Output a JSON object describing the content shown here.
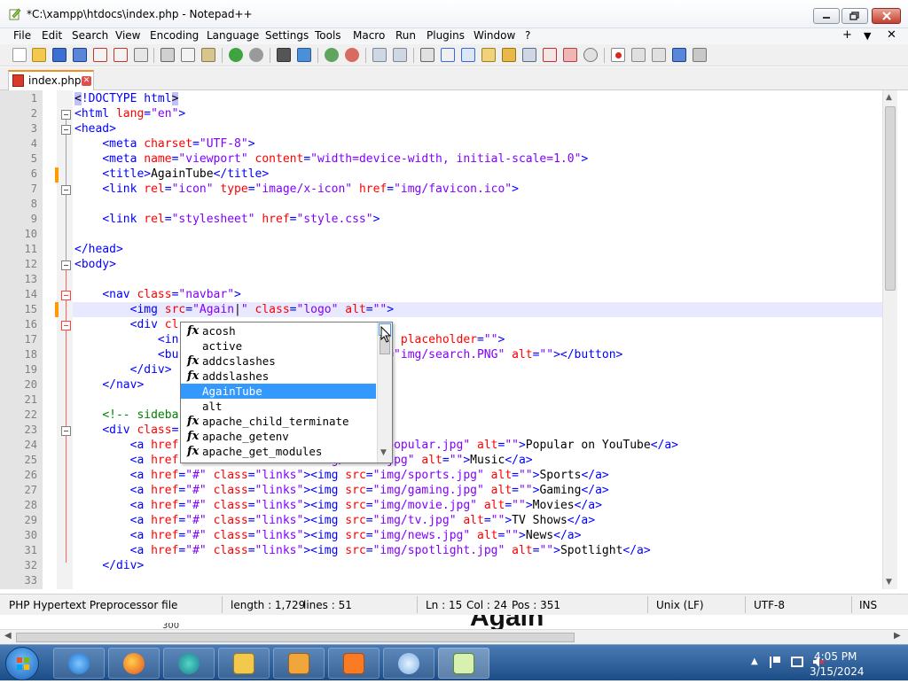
{
  "window": {
    "title": "*C:\\xampp\\htdocs\\index.php - Notepad++"
  },
  "menu": [
    "File",
    "Edit",
    "Search",
    "View",
    "Encoding",
    "Language",
    "Settings",
    "Tools",
    "Macro",
    "Run",
    "Plugins",
    "Window",
    "?"
  ],
  "menu_right": {
    "plus": "+",
    "down": "▼",
    "close": "✕"
  },
  "tab": {
    "label": "index.php"
  },
  "code_lines": [
    {
      "n": "1",
      "parts": [
        [
          "brk",
          "<"
        ],
        [
          "tag",
          "!DOCTYPE html"
        ],
        [
          "brk",
          ">"
        ]
      ]
    },
    {
      "n": "2",
      "parts": [
        [
          "tag",
          "<html "
        ],
        [
          "attr",
          "lang"
        ],
        [
          "tag",
          "="
        ],
        [
          "val",
          "\"en\""
        ],
        [
          "tag",
          ">"
        ]
      ]
    },
    {
      "n": "3",
      "parts": [
        [
          "tag",
          "<head>"
        ]
      ]
    },
    {
      "n": "4",
      "parts": [
        [
          "txt",
          "    "
        ],
        [
          "tag",
          "<meta "
        ],
        [
          "attr",
          "charset"
        ],
        [
          "tag",
          "="
        ],
        [
          "val",
          "\"UTF-8\""
        ],
        [
          "tag",
          ">"
        ]
      ]
    },
    {
      "n": "5",
      "parts": [
        [
          "txt",
          "    "
        ],
        [
          "tag",
          "<meta "
        ],
        [
          "attr",
          "name"
        ],
        [
          "tag",
          "="
        ],
        [
          "val",
          "\"viewport\""
        ],
        [
          "tag",
          " "
        ],
        [
          "attr",
          "content"
        ],
        [
          "tag",
          "="
        ],
        [
          "val",
          "\"width=device-width, initial-scale=1.0\""
        ],
        [
          "tag",
          ">"
        ]
      ]
    },
    {
      "n": "6",
      "parts": [
        [
          "txt",
          "    "
        ],
        [
          "tag",
          "<title>"
        ],
        [
          "txt",
          "AgainTube"
        ],
        [
          "tag",
          "</title>"
        ]
      ]
    },
    {
      "n": "7",
      "parts": [
        [
          "txt",
          "    "
        ],
        [
          "tag",
          "<link "
        ],
        [
          "attr",
          "rel"
        ],
        [
          "tag",
          "="
        ],
        [
          "val",
          "\"icon\""
        ],
        [
          "tag",
          " "
        ],
        [
          "attr",
          "type"
        ],
        [
          "tag",
          "="
        ],
        [
          "val",
          "\"image/x-icon\""
        ],
        [
          "tag",
          " "
        ],
        [
          "attr",
          "href"
        ],
        [
          "tag",
          "="
        ],
        [
          "val",
          "\"img/favicon.ico\""
        ],
        [
          "tag",
          ">"
        ]
      ]
    },
    {
      "n": "8",
      "parts": []
    },
    {
      "n": "9",
      "parts": [
        [
          "txt",
          "    "
        ],
        [
          "tag",
          "<link "
        ],
        [
          "attr",
          "rel"
        ],
        [
          "tag",
          "="
        ],
        [
          "val",
          "\"stylesheet\""
        ],
        [
          "tag",
          " "
        ],
        [
          "attr",
          "href"
        ],
        [
          "tag",
          "="
        ],
        [
          "val",
          "\"style.css\""
        ],
        [
          "tag",
          ">"
        ]
      ]
    },
    {
      "n": "10",
      "parts": []
    },
    {
      "n": "11",
      "parts": [
        [
          "tag",
          "</head>"
        ]
      ]
    },
    {
      "n": "12",
      "parts": [
        [
          "tag",
          "<body>"
        ]
      ]
    },
    {
      "n": "13",
      "parts": []
    },
    {
      "n": "14",
      "parts": [
        [
          "txt",
          "    "
        ],
        [
          "tag",
          "<nav "
        ],
        [
          "attr",
          "class"
        ],
        [
          "tag",
          "="
        ],
        [
          "val",
          "\"navbar\""
        ],
        [
          "tag",
          ">"
        ]
      ]
    },
    {
      "n": "15",
      "parts": [
        [
          "txt",
          "        "
        ],
        [
          "tag",
          "<img "
        ],
        [
          "attr",
          "src"
        ],
        [
          "tag",
          "="
        ],
        [
          "val",
          "\"Again"
        ],
        [
          "txt",
          "|"
        ],
        [
          "val",
          "\""
        ],
        [
          "tag",
          " "
        ],
        [
          "attr",
          "class"
        ],
        [
          "tag",
          "="
        ],
        [
          "val",
          "\"logo\""
        ],
        [
          "tag",
          " "
        ],
        [
          "attr",
          "alt"
        ],
        [
          "tag",
          "="
        ],
        [
          "val",
          "\"\""
        ],
        [
          "tag",
          ">"
        ]
      ]
    },
    {
      "n": "16",
      "parts": [
        [
          "txt",
          "        "
        ],
        [
          "tag",
          "<div "
        ],
        [
          "attr",
          "cl"
        ]
      ]
    },
    {
      "n": "17",
      "parts": [
        [
          "txt",
          "            "
        ],
        [
          "tag",
          "<in"
        ],
        [
          "txt",
          "                           "
        ],
        [
          "val",
          "bar\""
        ],
        [
          "tag",
          " "
        ],
        [
          "attr",
          "placeholder"
        ],
        [
          "tag",
          "="
        ],
        [
          "val",
          "\"\""
        ],
        [
          "tag",
          ">"
        ]
      ]
    },
    {
      "n": "18",
      "parts": [
        [
          "txt",
          "            "
        ],
        [
          "tag",
          "<bu"
        ],
        [
          "txt",
          "                           "
        ],
        [
          "attr",
          "src"
        ],
        [
          "tag",
          "="
        ],
        [
          "val",
          "\"img/search.PNG\""
        ],
        [
          "tag",
          " "
        ],
        [
          "attr",
          "alt"
        ],
        [
          "tag",
          "="
        ],
        [
          "val",
          "\"\""
        ],
        [
          "tag",
          "></button>"
        ]
      ]
    },
    {
      "n": "19",
      "parts": [
        [
          "txt",
          "        "
        ],
        [
          "tag",
          "</div>"
        ]
      ]
    },
    {
      "n": "20",
      "parts": [
        [
          "txt",
          "    "
        ],
        [
          "tag",
          "</nav>"
        ]
      ]
    },
    {
      "n": "21",
      "parts": []
    },
    {
      "n": "22",
      "parts": [
        [
          "txt",
          "    "
        ],
        [
          "cmt",
          "<!-- sideba"
        ]
      ]
    },
    {
      "n": "23",
      "parts": [
        [
          "txt",
          "    "
        ],
        [
          "tag",
          "<div "
        ],
        [
          "attr",
          "class"
        ],
        [
          "tag",
          "="
        ]
      ]
    },
    {
      "n": "24",
      "parts": [
        [
          "txt",
          "        "
        ],
        [
          "tag",
          "<a "
        ],
        [
          "attr",
          "href"
        ],
        [
          "txt",
          "                     "
        ],
        [
          "attr",
          "src"
        ],
        [
          "tag",
          "="
        ],
        [
          "val",
          "\"img/popular.jpg\""
        ],
        [
          "tag",
          " "
        ],
        [
          "attr",
          "alt"
        ],
        [
          "tag",
          "="
        ],
        [
          "val",
          "\"\""
        ],
        [
          "tag",
          ">"
        ],
        [
          "txt",
          "Popular on YouTube"
        ],
        [
          "tag",
          "</a>"
        ]
      ]
    },
    {
      "n": "25",
      "parts": [
        [
          "txt",
          "        "
        ],
        [
          "tag",
          "<a "
        ],
        [
          "attr",
          "href"
        ],
        [
          "txt",
          "                     "
        ],
        [
          "val",
          "mg/music.jpg\""
        ],
        [
          "tag",
          " "
        ],
        [
          "attr",
          "alt"
        ],
        [
          "tag",
          "="
        ],
        [
          "val",
          "\"\""
        ],
        [
          "tag",
          ">"
        ],
        [
          "txt",
          "Music"
        ],
        [
          "tag",
          "</a>"
        ]
      ]
    },
    {
      "n": "26",
      "parts": [
        [
          "txt",
          "        "
        ],
        [
          "tag",
          "<a "
        ],
        [
          "attr",
          "href"
        ],
        [
          "tag",
          "="
        ],
        [
          "val",
          "\"#\""
        ],
        [
          "tag",
          " "
        ],
        [
          "attr",
          "class"
        ],
        [
          "tag",
          "="
        ],
        [
          "val",
          "\"links\""
        ],
        [
          "tag",
          "><img "
        ],
        [
          "attr",
          "src"
        ],
        [
          "tag",
          "="
        ],
        [
          "val",
          "\"img/sports.jpg\""
        ],
        [
          "tag",
          " "
        ],
        [
          "attr",
          "alt"
        ],
        [
          "tag",
          "="
        ],
        [
          "val",
          "\"\""
        ],
        [
          "tag",
          ">"
        ],
        [
          "txt",
          "Sports"
        ],
        [
          "tag",
          "</a>"
        ]
      ]
    },
    {
      "n": "27",
      "parts": [
        [
          "txt",
          "        "
        ],
        [
          "tag",
          "<a "
        ],
        [
          "attr",
          "href"
        ],
        [
          "tag",
          "="
        ],
        [
          "val",
          "\"#\""
        ],
        [
          "tag",
          " "
        ],
        [
          "attr",
          "class"
        ],
        [
          "tag",
          "="
        ],
        [
          "val",
          "\"links\""
        ],
        [
          "tag",
          "><img "
        ],
        [
          "attr",
          "src"
        ],
        [
          "tag",
          "="
        ],
        [
          "val",
          "\"img/gaming.jpg\""
        ],
        [
          "tag",
          " "
        ],
        [
          "attr",
          "alt"
        ],
        [
          "tag",
          "="
        ],
        [
          "val",
          "\"\""
        ],
        [
          "tag",
          ">"
        ],
        [
          "txt",
          "Gaming"
        ],
        [
          "tag",
          "</a>"
        ]
      ]
    },
    {
      "n": "28",
      "parts": [
        [
          "txt",
          "        "
        ],
        [
          "tag",
          "<a "
        ],
        [
          "attr",
          "href"
        ],
        [
          "tag",
          "="
        ],
        [
          "val",
          "\"#\""
        ],
        [
          "tag",
          " "
        ],
        [
          "attr",
          "class"
        ],
        [
          "tag",
          "="
        ],
        [
          "val",
          "\"links\""
        ],
        [
          "tag",
          "><img "
        ],
        [
          "attr",
          "src"
        ],
        [
          "tag",
          "="
        ],
        [
          "val",
          "\"img/movie.jpg\""
        ],
        [
          "tag",
          " "
        ],
        [
          "attr",
          "alt"
        ],
        [
          "tag",
          "="
        ],
        [
          "val",
          "\"\""
        ],
        [
          "tag",
          ">"
        ],
        [
          "txt",
          "Movies"
        ],
        [
          "tag",
          "</a>"
        ]
      ]
    },
    {
      "n": "29",
      "parts": [
        [
          "txt",
          "        "
        ],
        [
          "tag",
          "<a "
        ],
        [
          "attr",
          "href"
        ],
        [
          "tag",
          "="
        ],
        [
          "val",
          "\"#\""
        ],
        [
          "tag",
          " "
        ],
        [
          "attr",
          "class"
        ],
        [
          "tag",
          "="
        ],
        [
          "val",
          "\"links\""
        ],
        [
          "tag",
          "><img "
        ],
        [
          "attr",
          "src"
        ],
        [
          "tag",
          "="
        ],
        [
          "val",
          "\"img/tv.jpg\""
        ],
        [
          "tag",
          " "
        ],
        [
          "attr",
          "alt"
        ],
        [
          "tag",
          "="
        ],
        [
          "val",
          "\"\""
        ],
        [
          "tag",
          ">"
        ],
        [
          "txt",
          "TV Shows"
        ],
        [
          "tag",
          "</a>"
        ]
      ]
    },
    {
      "n": "30",
      "parts": [
        [
          "txt",
          "        "
        ],
        [
          "tag",
          "<a "
        ],
        [
          "attr",
          "href"
        ],
        [
          "tag",
          "="
        ],
        [
          "val",
          "\"#\""
        ],
        [
          "tag",
          " "
        ],
        [
          "attr",
          "class"
        ],
        [
          "tag",
          "="
        ],
        [
          "val",
          "\"links\""
        ],
        [
          "tag",
          "><img "
        ],
        [
          "attr",
          "src"
        ],
        [
          "tag",
          "="
        ],
        [
          "val",
          "\"img/news.jpg\""
        ],
        [
          "tag",
          " "
        ],
        [
          "attr",
          "alt"
        ],
        [
          "tag",
          "="
        ],
        [
          "val",
          "\"\""
        ],
        [
          "tag",
          ">"
        ],
        [
          "txt",
          "News"
        ],
        [
          "tag",
          "</a>"
        ]
      ]
    },
    {
      "n": "31",
      "parts": [
        [
          "txt",
          "        "
        ],
        [
          "tag",
          "<a "
        ],
        [
          "attr",
          "href"
        ],
        [
          "tag",
          "="
        ],
        [
          "val",
          "\"#\""
        ],
        [
          "tag",
          " "
        ],
        [
          "attr",
          "class"
        ],
        [
          "tag",
          "="
        ],
        [
          "val",
          "\"links\""
        ],
        [
          "tag",
          "><img "
        ],
        [
          "attr",
          "src"
        ],
        [
          "tag",
          "="
        ],
        [
          "val",
          "\"img/spotlight.jpg\""
        ],
        [
          "tag",
          " "
        ],
        [
          "attr",
          "alt"
        ],
        [
          "tag",
          "="
        ],
        [
          "val",
          "\"\""
        ],
        [
          "tag",
          ">"
        ],
        [
          "txt",
          "Spotlight"
        ],
        [
          "tag",
          "</a>"
        ]
      ]
    },
    {
      "n": "32",
      "parts": [
        [
          "txt",
          "    "
        ],
        [
          "tag",
          "</div>"
        ]
      ]
    },
    {
      "n": "33",
      "parts": []
    }
  ],
  "autocomplete": {
    "items": [
      {
        "label": "acosh",
        "fx": true
      },
      {
        "label": "active",
        "fx": false
      },
      {
        "label": "addcslashes",
        "fx": true
      },
      {
        "label": "addslashes",
        "fx": true
      },
      {
        "label": "AgainTube",
        "fx": false,
        "selected": true
      },
      {
        "label": "alt",
        "fx": false
      },
      {
        "label": "apache_child_terminate",
        "fx": true
      },
      {
        "label": "apache_getenv",
        "fx": true
      },
      {
        "label": "apache_get_modules",
        "fx": true
      }
    ],
    "fx_glyph": "fx"
  },
  "status": {
    "file_type": "PHP Hypertext Preprocessor file",
    "length": "length : 1,729",
    "lines": "lines : 51",
    "ln": "Ln : 15",
    "col": "Col : 24",
    "pos": "Pos : 351",
    "eol": "Unix (LF)",
    "encoding": "UTF-8",
    "mode": "INS"
  },
  "background_peek": {
    "text": "Again",
    "number": "300"
  },
  "clock": {
    "time": "4:05 PM",
    "date": "3/15/2024"
  },
  "colors": {
    "tag": "#0000ff",
    "attr": "#ff0000",
    "value": "#8000ff",
    "comment": "#008000",
    "selection": "#3399ff",
    "tab_accent": "#f28f22"
  }
}
